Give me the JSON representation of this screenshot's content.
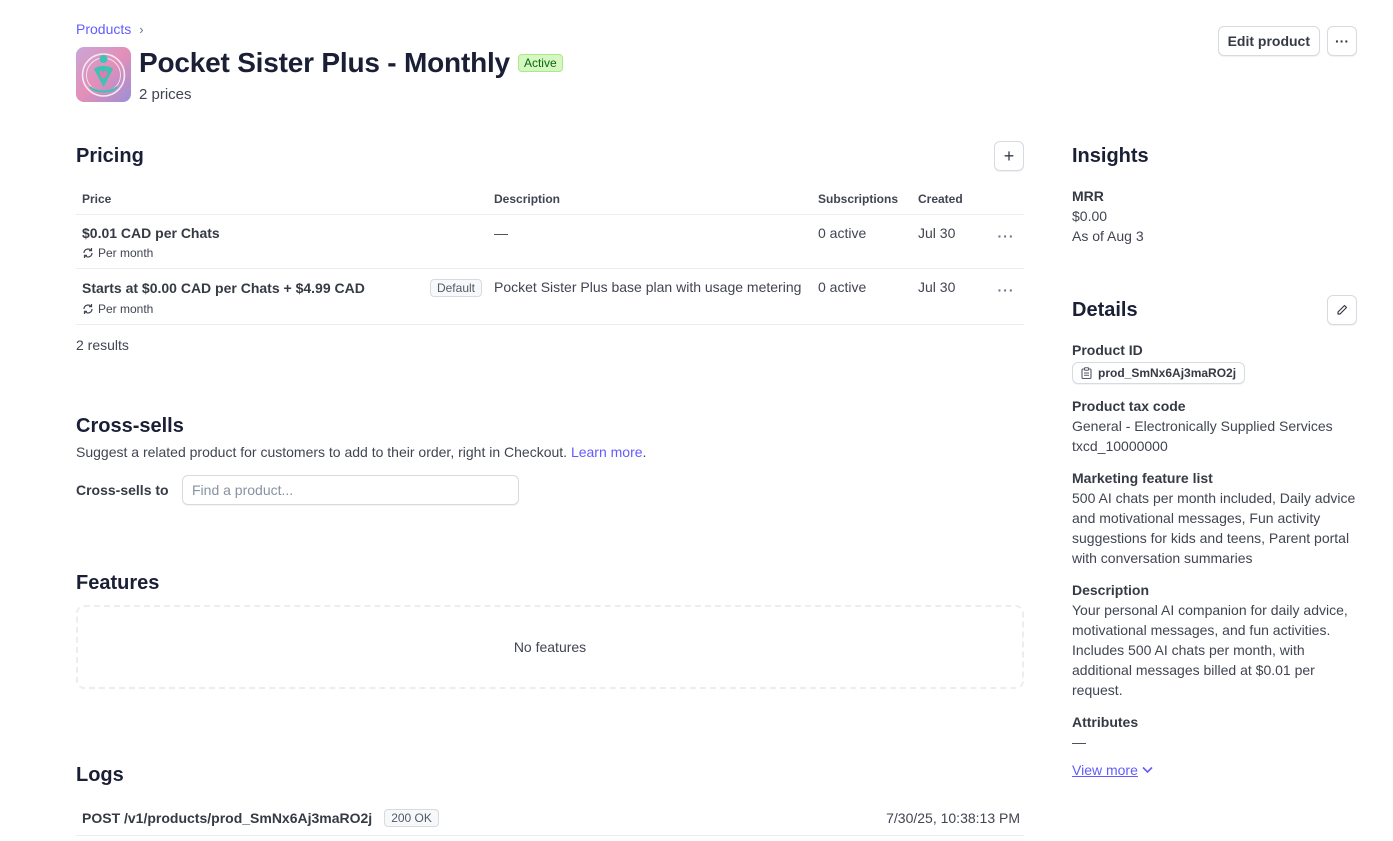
{
  "breadcrumb": {
    "products_label": "Products",
    "chevron": "›"
  },
  "header": {
    "title": "Pocket Sister Plus - Monthly",
    "status": "Active",
    "price_count": "2 prices",
    "edit_label": "Edit product",
    "more_label": "···"
  },
  "pricing": {
    "title": "Pricing",
    "add_label": "+",
    "columns": {
      "price": "Price",
      "description": "Description",
      "subscriptions": "Subscriptions",
      "created": "Created"
    },
    "rows": [
      {
        "price": "$0.01 CAD per Chats",
        "interval": "Per month",
        "badge": "",
        "description": "—",
        "subscriptions": "0 active",
        "created": "Jul 30",
        "more": "···"
      },
      {
        "price": "Starts at $0.00 CAD per Chats + $4.99 CAD",
        "interval": "Per month",
        "badge": "Default",
        "description": "Pocket Sister Plus base plan with usage metering",
        "subscriptions": "0 active",
        "created": "Jul 30",
        "more": "···"
      }
    ],
    "results": "2 results"
  },
  "crosssells": {
    "title": "Cross-sells",
    "description": "Suggest a related product for customers to add to their order, right in Checkout.",
    "learn_more": "Learn more",
    "label": "Cross-sells to",
    "placeholder": "Find a product..."
  },
  "features": {
    "title": "Features",
    "empty": "No features"
  },
  "logs": {
    "title": "Logs",
    "entries": [
      {
        "path": "POST /v1/products/prod_SmNx6Aj3maRO2j",
        "status": "200 OK",
        "time": "7/30/25, 10:38:13 PM"
      }
    ]
  },
  "insights": {
    "title": "Insights",
    "mrr_label": "MRR",
    "mrr_value": "$0.00",
    "as_of": "As of Aug 3"
  },
  "details": {
    "title": "Details",
    "product_id_label": "Product ID",
    "product_id": "prod_SmNx6Aj3maRO2j",
    "tax_code_label": "Product tax code",
    "tax_code_name": "General - Electronically Supplied Services",
    "tax_code_id": "txcd_10000000",
    "marketing_label": "Marketing feature list",
    "marketing_value": "500 AI chats per month included, Daily advice and motivational messages, Fun activity suggestions for kids and teens, Parent portal with conversation summaries",
    "description_label": "Description",
    "description_value": "Your personal AI companion for daily advice, motivational messages, and fun activities. Includes 500 AI chats per month, with additional messages billed at $0.01 per request.",
    "attributes_label": "Attributes",
    "attributes_value": "—",
    "view_more": "View more"
  },
  "colors": {
    "accent": "#635bff",
    "active_bg": "#d7f7c2",
    "active_text": "#05690d",
    "icon_teal": "#3cc3b4",
    "icon_pink": "#e07ab0"
  },
  "icons": [
    "product-logo-icon",
    "chevron-right-icon",
    "more-icon",
    "plus-icon",
    "recurring-icon",
    "clipboard-icon",
    "pencil-icon",
    "chevron-down-icon"
  ]
}
